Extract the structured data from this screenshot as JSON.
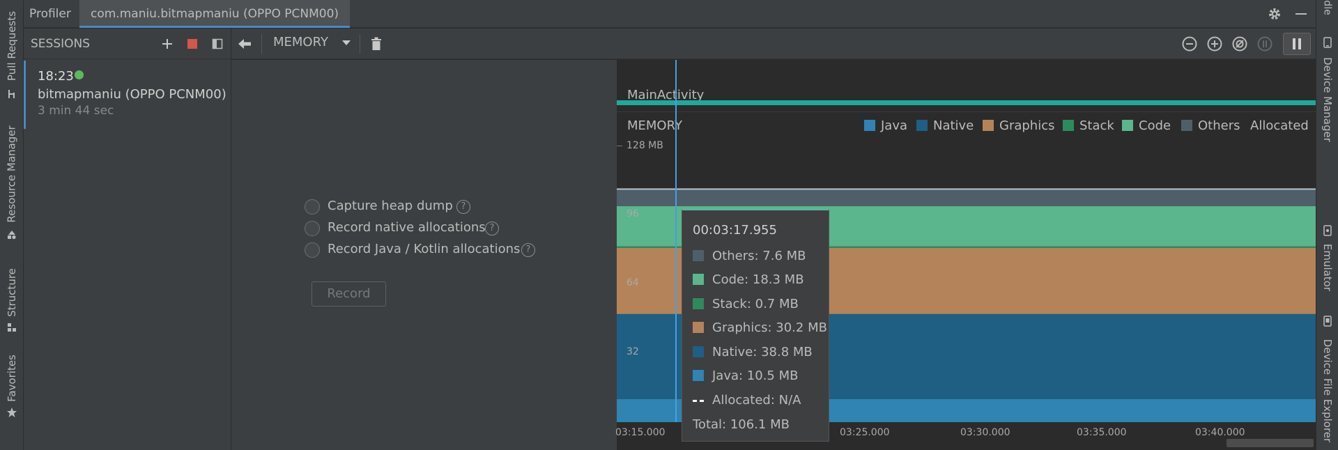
{
  "left_strip": {
    "tabs": [
      "Pull Requests",
      "Resource Manager",
      "Structure",
      "Favorites"
    ]
  },
  "right_strip": {
    "tabs": [
      "Device Manager",
      "Emulator",
      "Device File Explorer"
    ]
  },
  "tabbar": {
    "profiler_label": "Profiler",
    "active_tab": "com.maniu.bitmapmaniu (OPPO PCNM00)"
  },
  "sessions": {
    "title": "SESSIONS",
    "item": {
      "time": "18:23",
      "name": "bitmapmaniu (OPPO PCNM00)",
      "duration": "3 min 44 sec",
      "status_color": "#5fb85f"
    }
  },
  "toolbar": {
    "profiler_select": "MEMORY"
  },
  "capture": {
    "options": [
      "Capture heap dump",
      "Record native allocations",
      "Record Java / Kotlin allocations"
    ],
    "record_label": "Record"
  },
  "chart": {
    "activity_label": "MainActivity",
    "memory_label": "MEMORY",
    "legend": [
      {
        "name": "Java",
        "color": "#2f84b3"
      },
      {
        "name": "Native",
        "color": "#1f5f83"
      },
      {
        "name": "Graphics",
        "color": "#b5835a"
      },
      {
        "name": "Stack",
        "color": "#2e8a5e"
      },
      {
        "name": "Code",
        "color": "#5bb58d"
      },
      {
        "name": "Others",
        "color": "#4f5f6a"
      },
      {
        "name": "Allocated",
        "color": ""
      }
    ],
    "y_top_label": "128 MB",
    "y_ticks": [
      "96",
      "64",
      "32"
    ],
    "x_ticks": [
      "03:15.000",
      "03:25.000",
      "03:30.000",
      "03:35.000",
      "03:40.000"
    ]
  },
  "chart_data": {
    "type": "area",
    "title": "MEMORY",
    "xlabel": "",
    "ylabel": "",
    "y_unit": "MB",
    "ylim": [
      0,
      128
    ],
    "stack_order": [
      "Java",
      "Native",
      "Graphics",
      "Stack",
      "Code",
      "Others"
    ],
    "series": [
      {
        "name": "Java",
        "values": [
          10.5
        ]
      },
      {
        "name": "Native",
        "values": [
          38.8
        ]
      },
      {
        "name": "Graphics",
        "values": [
          30.2
        ]
      },
      {
        "name": "Stack",
        "values": [
          0.7
        ]
      },
      {
        "name": "Code",
        "values": [
          18.3
        ]
      },
      {
        "name": "Others",
        "values": [
          7.6
        ]
      }
    ],
    "grid": false,
    "legend_position": "top-right"
  },
  "tooltip": {
    "time": "00:03:17.955",
    "rows": [
      {
        "label": "Others: 7.6 MB",
        "color": "#4f5f6a"
      },
      {
        "label": "Code: 18.3 MB",
        "color": "#5bb58d"
      },
      {
        "label": "Stack: 0.7 MB",
        "color": "#2e8a5e"
      },
      {
        "label": "Graphics: 30.2 MB",
        "color": "#b5835a"
      },
      {
        "label": "Native: 38.8 MB",
        "color": "#1f5f83"
      },
      {
        "label": "Java: 10.5 MB",
        "color": "#2f84b3"
      }
    ],
    "allocated": "Allocated: N/A",
    "total": "Total: 106.1 MB"
  }
}
